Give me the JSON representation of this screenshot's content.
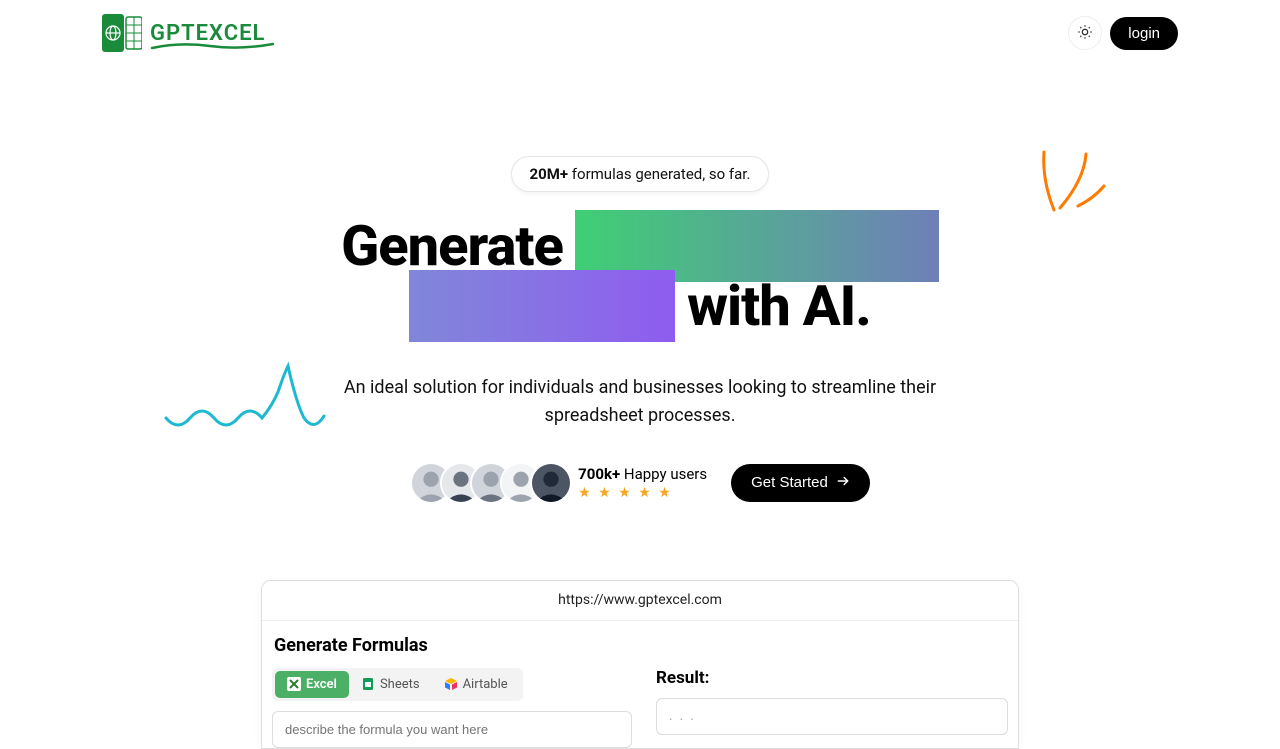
{
  "header": {
    "brand": "GPTEXCEL",
    "login_label": "login"
  },
  "hero": {
    "badge_count": "20M+",
    "badge_text": " formulas generated, so far.",
    "headline_1": "Generate",
    "headline_2": "with AI.",
    "subline": "An ideal solution for individuals and businesses looking to streamline their spreadsheet processes.",
    "users_count": "700k+",
    "users_label": " Happy users",
    "stars": "★ ★ ★ ★ ★",
    "cta_label": "Get Started"
  },
  "browser": {
    "url": "https://www.gptexcel.com",
    "gen_title": "Generate Formulas",
    "tabs": {
      "excel": "Excel",
      "sheets": "Sheets",
      "airtable": "Airtable"
    },
    "input_placeholder": "describe the formula you want here",
    "result_label": "Result:",
    "result_value": ". . ."
  }
}
